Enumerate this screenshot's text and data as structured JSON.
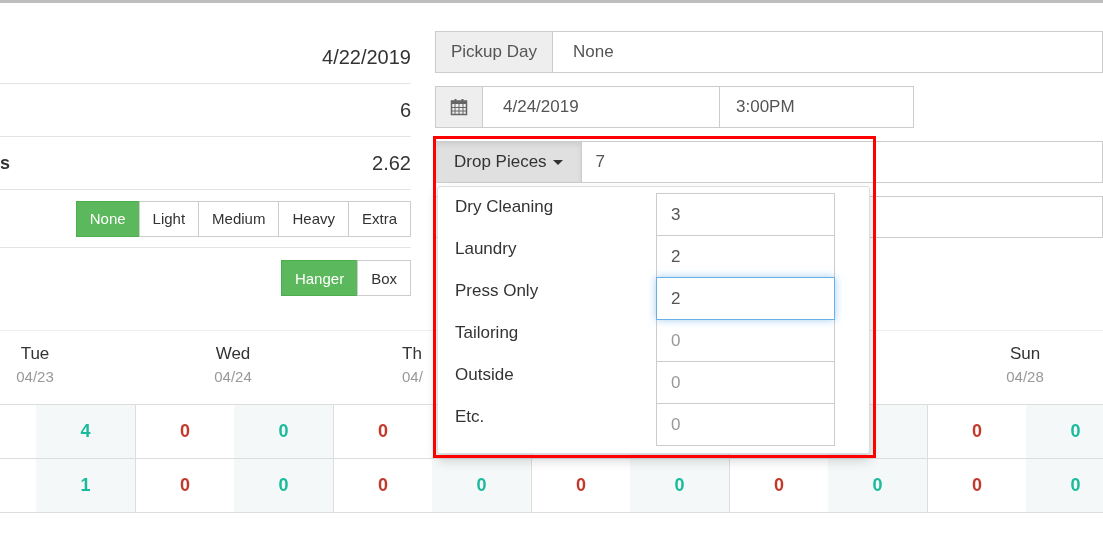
{
  "summary_rows": [
    {
      "value": "4/22/2019"
    },
    {
      "value": "6"
    },
    {
      "label": "s",
      "value": "2.62"
    }
  ],
  "starch": {
    "options": [
      {
        "label": "None",
        "selected": true
      },
      {
        "label": "Light",
        "selected": false
      },
      {
        "label": "Medium",
        "selected": false
      },
      {
        "label": "Heavy",
        "selected": false
      },
      {
        "label": "Extra",
        "selected": false
      }
    ]
  },
  "packaging": {
    "options": [
      {
        "label": "Hanger",
        "selected": true
      },
      {
        "label": "Box",
        "selected": false
      }
    ]
  },
  "pickup": {
    "label": "Pickup Day",
    "value": "None"
  },
  "delivery": {
    "date": "4/24/2019",
    "time": "3:00PM"
  },
  "drop_pieces": {
    "label": "Drop Pieces",
    "value": "7",
    "expanded": true,
    "items": [
      {
        "label": "Dry Cleaning",
        "value": "3",
        "focused": false
      },
      {
        "label": "Laundry",
        "value": "2",
        "focused": false
      },
      {
        "label": "Press Only",
        "value": "2",
        "focused": true
      },
      {
        "label": "Tailoring",
        "placeholder": "0",
        "focused": false
      },
      {
        "label": "Outside",
        "placeholder": "0",
        "focused": false
      },
      {
        "label": "Etc.",
        "placeholder": "0",
        "focused": false
      }
    ]
  },
  "calendar": {
    "days": [
      {
        "name": "Tue",
        "date": "04/23"
      },
      {
        "name": "Wed",
        "date": "04/24"
      },
      {
        "name": "Th",
        "date": "04/"
      },
      {
        "name": "Sun",
        "date": "04/28"
      }
    ],
    "rows": [
      {
        "cells": [
          {
            "text": "4",
            "color": "#1abb9c"
          },
          {
            "text": "0",
            "color": "#c0392b"
          },
          {
            "text": "0",
            "color": "#1abb9c"
          },
          {
            "text": "0",
            "color": "#c0392b"
          },
          null,
          null,
          null,
          null,
          null,
          {
            "text": "0",
            "color": "#c0392b"
          },
          {
            "text": "0",
            "color": "#1abb9c"
          }
        ]
      },
      {
        "cells": [
          {
            "text": "1",
            "color": "#1abb9c"
          },
          {
            "text": "0",
            "color": "#c0392b"
          },
          {
            "text": "0",
            "color": "#1abb9c"
          },
          {
            "text": "0",
            "color": "#c0392b"
          },
          {
            "text": "0",
            "color": "#1abb9c"
          },
          {
            "text": "0",
            "color": "#c0392b"
          },
          {
            "text": "0",
            "color": "#1abb9c"
          },
          {
            "text": "0",
            "color": "#c0392b"
          },
          {
            "text": "0",
            "color": "#1abb9c"
          },
          {
            "text": "0",
            "color": "#c0392b"
          },
          {
            "text": "0",
            "color": "#1abb9c"
          }
        ]
      }
    ]
  }
}
